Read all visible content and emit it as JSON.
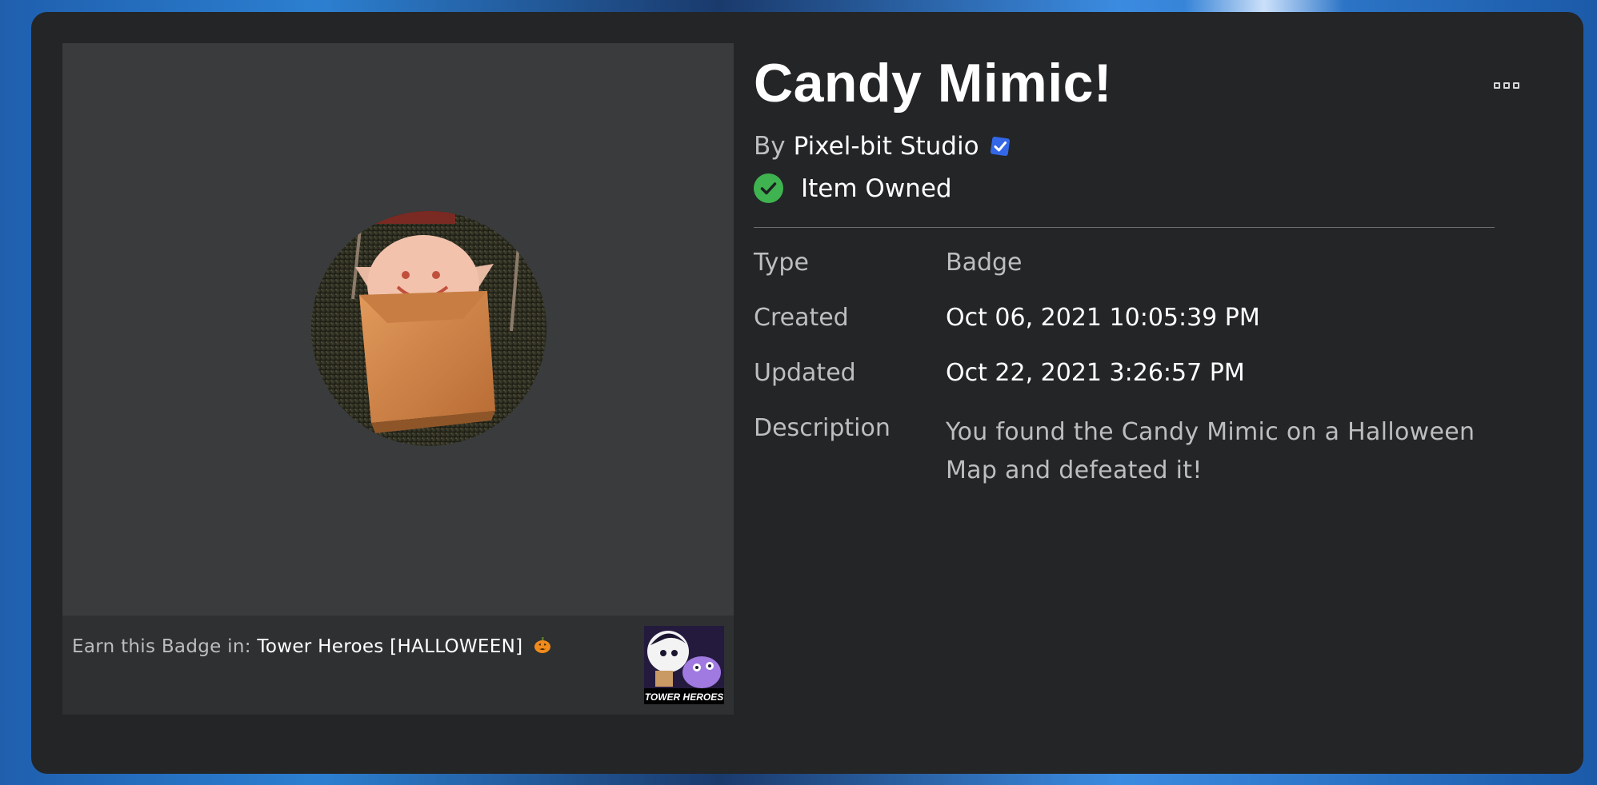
{
  "item": {
    "title": "Candy Mimic!",
    "by_label": "By",
    "creator": "Pixel-bit Studio",
    "owned_label": "Item Owned"
  },
  "earn": {
    "prefix": "Earn this Badge in:",
    "game_name": "Tower Heroes [HALLOWEEN]",
    "game_thumb_caption": "TOWER HEROES"
  },
  "details": {
    "type_label": "Type",
    "type_value": "Badge",
    "created_label": "Created",
    "created_value": "Oct 06, 2021 10:05:39 PM",
    "updated_label": "Updated",
    "updated_value": "Oct 22, 2021 3:26:57 PM",
    "description_label": "Description",
    "description_value": "You found the Candy Mimic on a Halloween Map and defeated it!"
  },
  "icons": {
    "verified": "verified-badge-icon",
    "owned": "check-circle-icon",
    "more": "more-options-icon",
    "pumpkin": "jack-o-lantern-icon"
  },
  "colors": {
    "panel_bg": "#232527",
    "thumb_bg": "#393b3d",
    "owned_green": "#3fb34f",
    "verified_blue": "#3367e8"
  }
}
